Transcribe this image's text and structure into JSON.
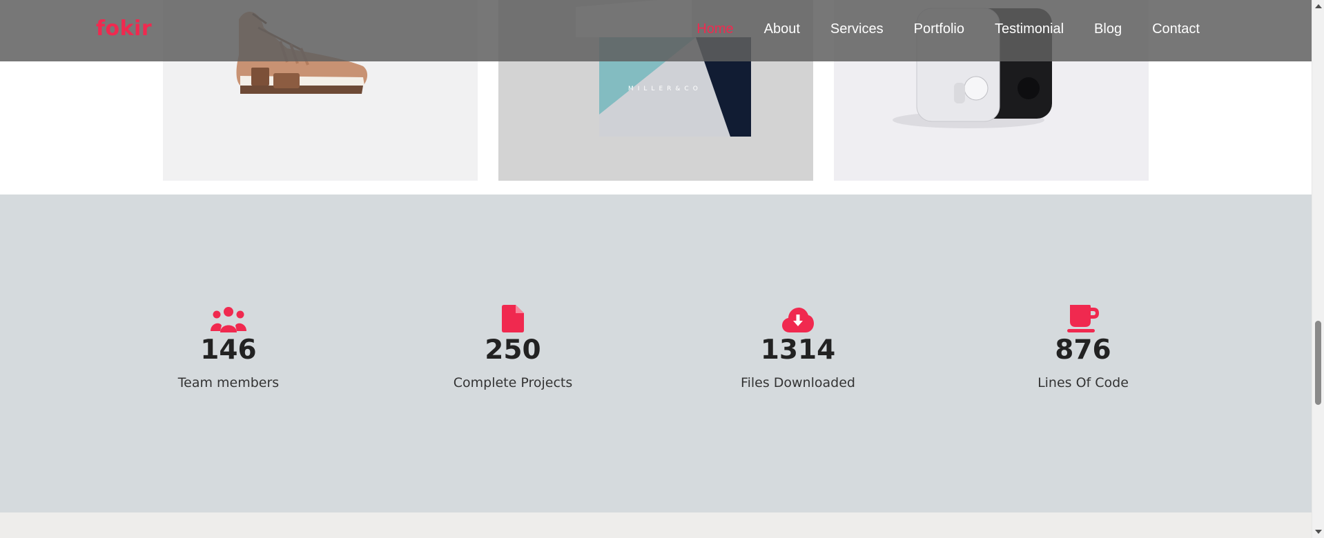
{
  "brand": "fokir",
  "nav": [
    {
      "label": "Home",
      "active": true
    },
    {
      "label": "About"
    },
    {
      "label": "Services"
    },
    {
      "label": "Portfolio"
    },
    {
      "label": "Testimonial"
    },
    {
      "label": "Blog"
    },
    {
      "label": "Contact"
    }
  ],
  "portfolio": {
    "items": [
      {
        "icon": "sneaker-image"
      },
      {
        "icon": "business-card-image",
        "card_text": "MILLER&CO"
      },
      {
        "icon": "device-image"
      }
    ]
  },
  "counters": [
    {
      "icon": "users-icon",
      "value": "146",
      "label": "Team members"
    },
    {
      "icon": "file-icon",
      "value": "250",
      "label": "Complete Projects"
    },
    {
      "icon": "cloud-download-icon",
      "value": "1314",
      "label": "Files Downloaded"
    },
    {
      "icon": "coffee-cup-icon",
      "value": "876",
      "label": "Lines Of Code"
    }
  ],
  "colors": {
    "accent": "#f0294f",
    "counter_bg": "#d5dadd",
    "navbar_bg": "#5f5f5f"
  }
}
